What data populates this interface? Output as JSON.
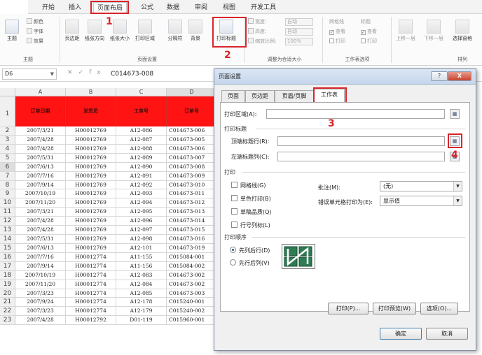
{
  "ribbon_tabs": [
    {
      "label": "开始"
    },
    {
      "label": "插入"
    },
    {
      "label": "页面布局"
    },
    {
      "label": "公式"
    },
    {
      "label": "数据"
    },
    {
      "label": "审阅"
    },
    {
      "label": "视图"
    },
    {
      "label": "开发工具"
    }
  ],
  "ribbon": {
    "theme": {
      "main": "主题",
      "colors": "颜色",
      "fonts": "字体",
      "effects": "效果",
      "group": "主题"
    },
    "page_setup": {
      "margins": "页边距",
      "orientation": "纸张方向",
      "size": "纸张大小",
      "print_area": "打印区域",
      "breaks": "分隔符",
      "background": "背景",
      "print_titles": "打印标题",
      "group": "页面设置"
    },
    "scale": {
      "width": "宽度:",
      "height": "高度:",
      "scale": "缩放比例:",
      "auto1": "自动",
      "auto2": "自动",
      "pct": "100%",
      "group": "调整为合适大小"
    },
    "sheet_options": {
      "gridlines": "网格线",
      "headings": "标题",
      "view1": "查看",
      "view2": "查看",
      "print1": "打印",
      "print2": "打印",
      "group": "工作表选项"
    },
    "arrange": {
      "forward": "上移一层",
      "backward": "下移一层",
      "pane": "选择窗格",
      "group": "排列"
    }
  },
  "annotations": {
    "n1": "1",
    "n2": "2",
    "n3": "3",
    "n4": "4"
  },
  "formula_bar": {
    "name_box": "D6",
    "fx": "fx",
    "content": "C014673-008"
  },
  "sheet": {
    "columns": [
      "A",
      "B",
      "C",
      "D"
    ],
    "header_row": [
      "订单日期",
      "发货员",
      "工单号",
      "订单号"
    ],
    "rows": [
      [
        "2007/3/21",
        "H00012769",
        "A12-086",
        "C014673-006"
      ],
      [
        "2007/4/28",
        "H00012769",
        "A12-087",
        "C014673-005"
      ],
      [
        "2007/4/28",
        "H00012769",
        "A12-088",
        "C014673-006"
      ],
      [
        "2007/5/31",
        "H00012769",
        "A12-089",
        "C014673-007"
      ],
      [
        "2007/6/13",
        "H00012769",
        "A12-090",
        "C014673-008"
      ],
      [
        "2007/7/16",
        "H00012769",
        "A12-091",
        "C014673-009"
      ],
      [
        "2007/9/14",
        "H00012769",
        "A12-092",
        "C014673-010"
      ],
      [
        "2007/10/19",
        "H00012769",
        "A12-093",
        "C014673-011"
      ],
      [
        "2007/11/20",
        "H00012769",
        "A12-094",
        "C014673-012"
      ],
      [
        "2007/3/21",
        "H00012769",
        "A12-095",
        "C014673-013"
      ],
      [
        "2007/4/28",
        "H00012769",
        "A12-096",
        "C014673-014"
      ],
      [
        "2007/4/28",
        "H00012769",
        "A12-097",
        "C014673-015"
      ],
      [
        "2007/5/31",
        "H00012769",
        "A12-098",
        "C014673-016"
      ],
      [
        "2007/6/13",
        "H00012769",
        "A12-101",
        "C014673-019"
      ],
      [
        "2007/7/16",
        "H00012774",
        "A11-155",
        "C015084-001"
      ],
      [
        "2007/9/14",
        "H00012774",
        "A11-156",
        "C015084-002"
      ],
      [
        "2007/10/19",
        "H00012774",
        "A12-083",
        "C014673-002"
      ],
      [
        "2007/11/20",
        "H00012774",
        "A12-084",
        "C014673-002"
      ],
      [
        "2007/3/23",
        "H00012774",
        "A12-085",
        "C014673-003"
      ],
      [
        "2007/9/24",
        "H00012774",
        "A12-178",
        "C015240-001"
      ],
      [
        "2007/3/23",
        "H00012774",
        "A12-179",
        "C015240-002"
      ],
      [
        "2007/4/28",
        "H00012792",
        "D01-119",
        "C015960-001"
      ]
    ]
  },
  "dialog": {
    "title": "页面设置",
    "help": "?",
    "close": "X",
    "tabs": [
      "页面",
      "页边距",
      "页眉/页脚",
      "工作表"
    ],
    "print_area_label": "打印区域(A):",
    "print_titles_section": "打印标题",
    "rows_repeat_label": "顶端标题行(R):",
    "cols_repeat_label": "左端标题列(C):",
    "print_section": "打印",
    "gridlines": "网格线(G)",
    "black_white": "单色打印(B)",
    "draft": "草稿品质(Q)",
    "row_col_headings": "行号列标(L)",
    "comments_label": "批注(M):",
    "comments_value": "(无)",
    "errors_label": "错误单元格打印为(E):",
    "errors_value": "显示值",
    "page_order_section": "打印顺序",
    "down_then_over": "先列后行(D)",
    "over_then_down": "先行后列(V)",
    "print_btn": "打印(P)...",
    "preview_btn": "打印预览(W)",
    "options_btn": "选项(O)...",
    "ok_btn": "确定",
    "cancel_btn": "取消"
  },
  "colors": {
    "accent_red": "#d9242a",
    "header_fill": "#ff1313"
  }
}
